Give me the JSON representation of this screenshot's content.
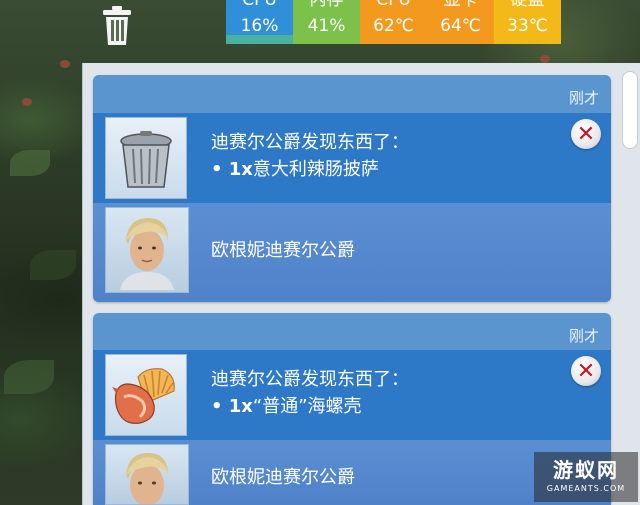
{
  "stats": [
    {
      "label": "CPU",
      "value": "16%",
      "color": "#2f8fd8",
      "bar": "#4ab0a0"
    },
    {
      "label": "内存",
      "value": "41%",
      "color": "#7cc24a",
      "bar": "#7cc24a"
    },
    {
      "label": "CPU",
      "value": "62℃",
      "color": "#f39a1e",
      "bar": "#f39a1e"
    },
    {
      "label": "显卡",
      "value": "64℃",
      "color": "#f39a1e",
      "bar": "#f39a1e"
    },
    {
      "label": "硬盘",
      "value": "33℃",
      "color": "#f2b918",
      "bar": "#f2b918"
    }
  ],
  "notifications": [
    {
      "time": "刚才",
      "title": "迪赛尔公爵发现东西了：",
      "item_prefix": "• 1x",
      "item_name": "意大利辣肠披萨",
      "icon": "trash-can-icon",
      "sim_name": "欧根妮迪赛尔公爵"
    },
    {
      "time": "刚才",
      "title": "迪赛尔公爵发现东西了：",
      "item_prefix": "• 1x",
      "item_name": "“普通”海螺壳",
      "icon": "seashell-icon",
      "sim_name": "欧根妮迪赛尔公爵"
    }
  ],
  "watermark": {
    "brand": "游蚁网",
    "domain": "GAMEANTS.COM"
  }
}
